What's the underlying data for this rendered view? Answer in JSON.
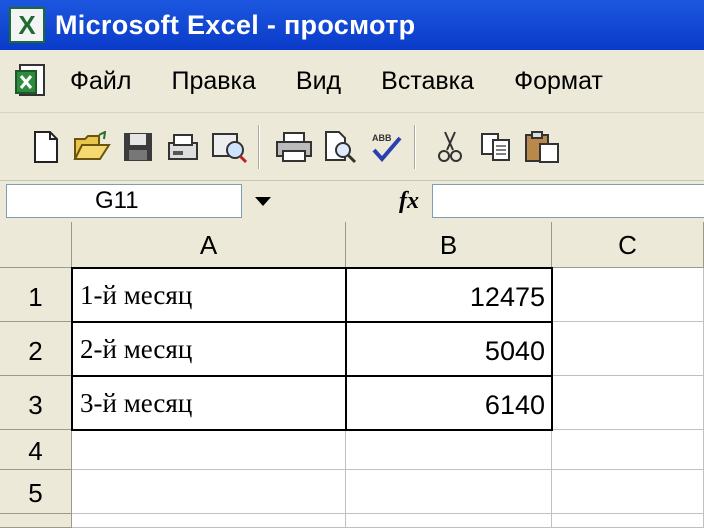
{
  "window": {
    "title": "Microsoft Excel - просмотр",
    "app_icon": "excel-icon"
  },
  "menu": {
    "items": [
      "Файл",
      "Правка",
      "Вид",
      "Вставка",
      "Формат"
    ],
    "doc_icon": "workbook-icon"
  },
  "toolbar": {
    "buttons": [
      "new-document-icon",
      "open-folder-icon",
      "save-icon",
      "email-icon",
      "web-search-icon",
      "print-icon",
      "print-preview-icon",
      "spelling-icon",
      "cut-icon",
      "copy-icon",
      "paste-icon"
    ]
  },
  "formula_bar": {
    "name_box": "G11",
    "fx_label": "fx",
    "formula": ""
  },
  "sheet": {
    "columns": [
      "A",
      "B",
      "C"
    ],
    "rows": [
      {
        "num": "1",
        "a": "1-й месяц",
        "b": "12475",
        "c": ""
      },
      {
        "num": "2",
        "a": "2-й месяц",
        "b": "5040",
        "c": ""
      },
      {
        "num": "3",
        "a": "3-й месяц",
        "b": "6140",
        "c": ""
      },
      {
        "num": "4",
        "a": "",
        "b": "",
        "c": ""
      },
      {
        "num": "5",
        "a": "",
        "b": "",
        "c": ""
      }
    ]
  },
  "colors": {
    "title_bar": "#0a3bc8",
    "chrome": "#ece9d8",
    "grid_line": "#c0c0c0"
  }
}
